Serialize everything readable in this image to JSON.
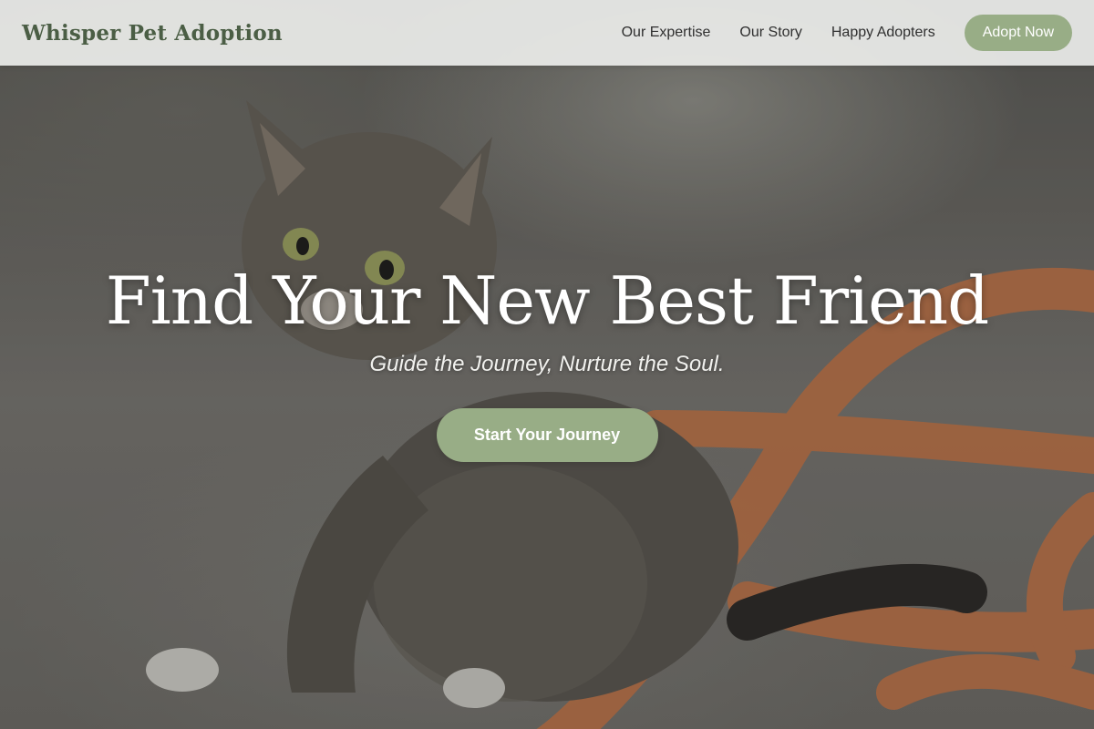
{
  "brand": {
    "name": "Whisper Pet Adoption"
  },
  "nav": {
    "links": [
      "Our Expertise",
      "Our Story",
      "Happy Adopters"
    ],
    "cta_label": "Adopt Now"
  },
  "hero": {
    "title": "Find Your New Best Friend",
    "subtitle": "Guide the Journey, Nurture the Soul.",
    "cta_label": "Start Your Journey",
    "image_subject": "tabby kitten sitting on pavement beside orange tubing"
  },
  "colors": {
    "accent": "#98ad86",
    "brand_text": "#4b5e45",
    "nav_background": "#ebecea"
  }
}
